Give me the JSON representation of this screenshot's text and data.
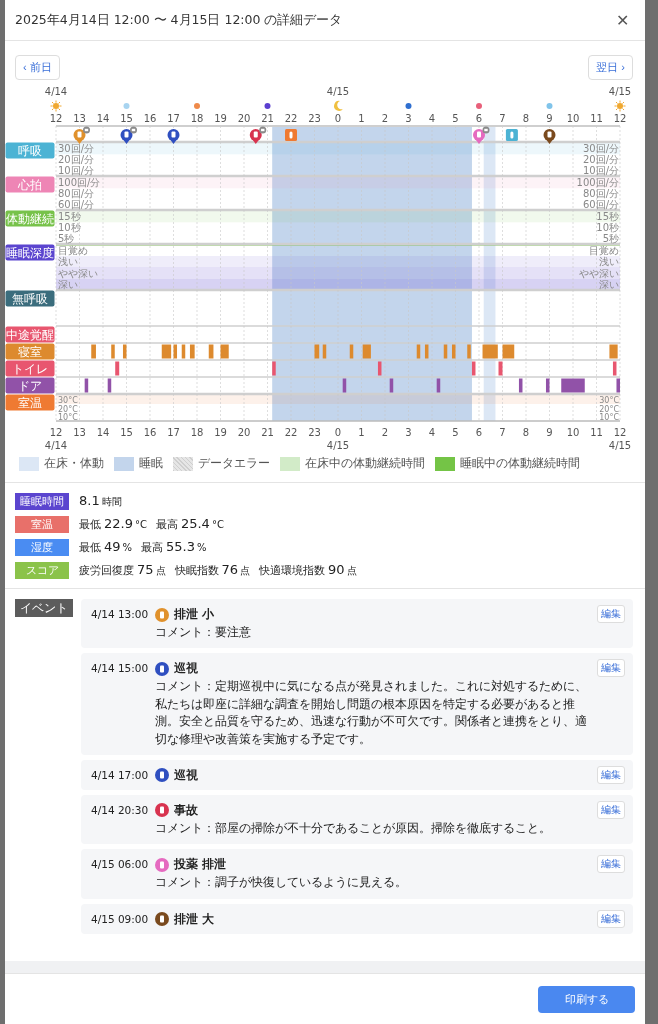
{
  "dialog": {
    "title": "2025年4月14日 12:00 〜 4月15日 12:00 の詳細データ",
    "close": "✕"
  },
  "nav": {
    "prev": "‹ 前日",
    "next": "翌日 ›"
  },
  "top_markers": [
    {
      "kind": "sun",
      "date": "4/14",
      "color": "#f0a830"
    },
    {
      "kind": "dot",
      "color": "#a8d4f0"
    },
    {
      "kind": "dot",
      "color": "#ef8a4a"
    },
    {
      "kind": "dot",
      "color": "#5b3fd0"
    },
    {
      "kind": "moon",
      "date": "4/15",
      "color": "#f0c040"
    },
    {
      "kind": "dot",
      "color": "#2f6fd0"
    },
    {
      "kind": "dot",
      "color": "#e8607a"
    },
    {
      "kind": "dot",
      "color": "#80c4ea"
    },
    {
      "kind": "sun",
      "date": "4/15",
      "color": "#f0a830"
    }
  ],
  "top_axis_labels": [
    "12",
    "13",
    "14",
    "15",
    "16",
    "17",
    "18",
    "19",
    "20",
    "21",
    "22",
    "23",
    "0",
    "1",
    "2",
    "3",
    "4",
    "5",
    "6",
    "7",
    "8",
    "9",
    "10",
    "11",
    "12"
  ],
  "markers": [
    {
      "kind": "pin",
      "color": "#e0912c",
      "comment": true
    },
    {
      "kind": "pin",
      "color": "#2f4fc0",
      "comment": true
    },
    {
      "kind": "pin",
      "color": "#2f4fc0",
      "comment": false
    },
    {
      "kind": "pin",
      "color": "#d8334f",
      "comment": true
    },
    {
      "kind": "square",
      "color": "#ef7a32",
      "comment": false
    },
    {
      "kind": "pin",
      "color": "#e56ac0",
      "comment": true
    },
    {
      "kind": "square",
      "color": "#4cb3d4",
      "comment": false
    },
    {
      "kind": "pin",
      "color": "#7a4a1e",
      "comment": false
    }
  ],
  "rows": [
    {
      "label": "呼吸",
      "color": "#4cb3d4",
      "kind": "vital",
      "scale": [
        "30回/分",
        "20回/分",
        "10回/分"
      ],
      "scale_right": [
        "30回/分",
        "20回/分",
        "10回/分"
      ]
    },
    {
      "label": "心拍",
      "color": "#ee85b5",
      "kind": "vital",
      "scale": [
        "100回/分",
        "80回/分",
        "60回/分"
      ],
      "scale_right": [
        "100回/分",
        "80回/分",
        "60回/分"
      ]
    },
    {
      "label": "体動継続",
      "color": "#77c24a",
      "kind": "vital",
      "scale": [
        "15秒",
        "10秒",
        "5秒"
      ],
      "scale_right": [
        "15秒",
        "10秒",
        "5秒"
      ]
    },
    {
      "label": "睡眠深度",
      "color": "#5b45cf",
      "kind": "depth",
      "scale": [
        "目覚め",
        "浅い",
        "やや深い",
        "深い"
      ],
      "scale_right": [
        "目覚め",
        "浅い",
        "やや深い",
        "深い"
      ]
    },
    {
      "label": "無呼吸",
      "color": "#3b6d7d",
      "kind": "blank"
    },
    {
      "label": "中途覚醒",
      "color": "#e8566f",
      "kind": "empty"
    },
    {
      "label": "寝室",
      "color": "#dd8a2e",
      "kind": "bars"
    },
    {
      "label": "トイレ",
      "color": "#e8566f",
      "kind": "bars"
    },
    {
      "label": "ドア",
      "color": "#9152a8",
      "kind": "bars"
    },
    {
      "label": "室温",
      "color": "#ef7a32",
      "kind": "temp",
      "scale": [
        "30°C",
        "20°C",
        "10°C"
      ],
      "scale_right": [
        "30°C",
        "20°C",
        "10°C"
      ]
    }
  ],
  "bottom_axis_labels": [
    "12",
    "13",
    "14",
    "15",
    "16",
    "17",
    "18",
    "19",
    "20",
    "21",
    "22",
    "23",
    "0",
    "1",
    "2",
    "3",
    "4",
    "5",
    "6",
    "7",
    "8",
    "9",
    "10",
    "11",
    "12"
  ],
  "bottom_dates": [
    "4/14",
    "4/15",
    "4/15"
  ],
  "legend": [
    {
      "label": "在床・体動",
      "color": "#dce7f5",
      "kind": "solid"
    },
    {
      "label": "睡眠",
      "color": "#c3d5ec",
      "kind": "solid"
    },
    {
      "label": "データエラー",
      "color": "#e6e6e6",
      "kind": "hatch"
    },
    {
      "label": "在床中の体動継続時間",
      "color": "#d2ebc8",
      "kind": "solid"
    },
    {
      "label": "睡眠中の体動継続時間",
      "color": "#74c446",
      "kind": "solid"
    }
  ],
  "summary": [
    {
      "label": "睡眠時間",
      "color": "#5b45cf",
      "parts": [
        {
          "text": "8.1",
          "kind": "num"
        },
        {
          "text": "時間",
          "kind": "unit"
        }
      ]
    },
    {
      "label": "室温",
      "color": "#e8706a",
      "parts": [
        {
          "text": "最低",
          "kind": "label"
        },
        {
          "text": "22.9",
          "kind": "num"
        },
        {
          "text": "°C",
          "kind": "unit"
        },
        {
          "text": "最高",
          "kind": "label"
        },
        {
          "text": "25.4",
          "kind": "num"
        },
        {
          "text": "°C",
          "kind": "unit"
        }
      ]
    },
    {
      "label": "湿度",
      "color": "#4a8cf2",
      "parts": [
        {
          "text": "最低",
          "kind": "label"
        },
        {
          "text": "49",
          "kind": "num"
        },
        {
          "text": "%",
          "kind": "unit"
        },
        {
          "text": "最高",
          "kind": "label"
        },
        {
          "text": "55.3",
          "kind": "num"
        },
        {
          "text": "%",
          "kind": "unit"
        }
      ]
    },
    {
      "label": "スコア",
      "color": "#8bc34a",
      "parts": [
        {
          "text": "疲労回復度",
          "kind": "label"
        },
        {
          "text": "75",
          "kind": "num"
        },
        {
          "text": "点",
          "kind": "unit"
        },
        {
          "text": "快眠指数",
          "kind": "label"
        },
        {
          "text": "76",
          "kind": "num"
        },
        {
          "text": "点",
          "kind": "unit"
        },
        {
          "text": "快適環境指数",
          "kind": "label"
        },
        {
          "text": "90",
          "kind": "num"
        },
        {
          "text": "点",
          "kind": "unit"
        }
      ]
    }
  ],
  "events_label": "イベント",
  "events": [
    {
      "time": "4/14 13:00",
      "color": "#e0912c",
      "title": "排泄 小",
      "comment": "コメント：要注意",
      "edit": "編集"
    },
    {
      "time": "4/14 15:00",
      "color": "#2f4fc0",
      "title": "巡視",
      "comment": "コメント：定期巡視中に気になる点が発見されました。これに対処するために、私たちは即座に詳細な調査を開始し問題の根本原因を特定する必要があると推測。安全と品質を守るため、迅速な行動が不可欠です。関係者と連携をとり、適切な修理や改善策を実施する予定です。",
      "edit": "編集"
    },
    {
      "time": "4/14 17:00",
      "color": "#2f4fc0",
      "title": "巡視",
      "edit": "編集"
    },
    {
      "time": "4/14 20:30",
      "color": "#d8334f",
      "title": "事故",
      "comment": "コメント：部屋の掃除が不十分であることが原因。掃除を徹底すること。",
      "edit": "編集"
    },
    {
      "time": "4/15 06:00",
      "color": "#e56ac0",
      "title": "投薬 排泄",
      "comment": "コメント：調子が快復しているように見える。",
      "edit": "編集"
    },
    {
      "time": "4/15 09:00",
      "color": "#7a4a1e",
      "title": "排泄 大",
      "edit": "編集"
    }
  ],
  "print_button": "印刷する"
}
